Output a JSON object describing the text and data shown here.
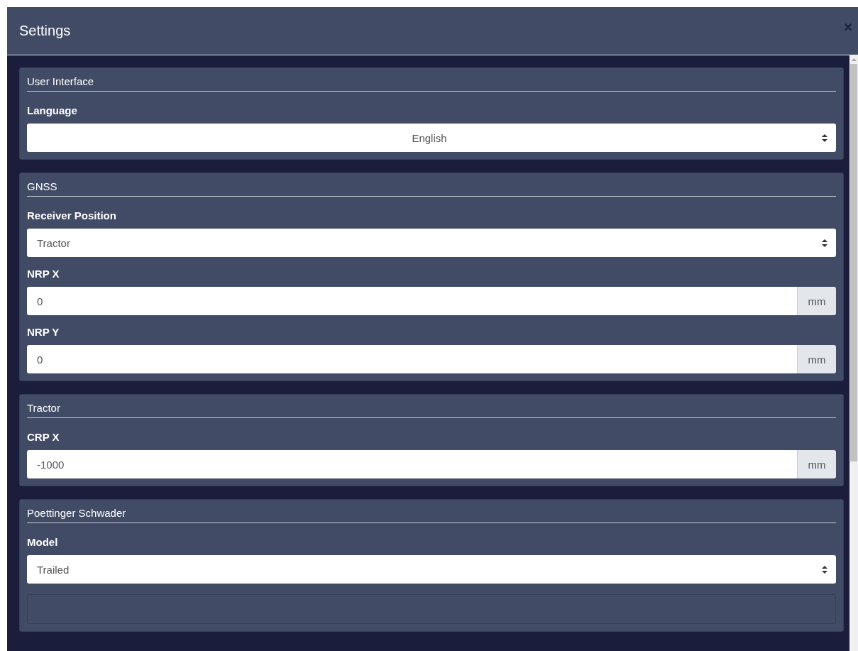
{
  "window": {
    "title": "Settings",
    "close": "×"
  },
  "sections": [
    {
      "title": "User Interface",
      "fields": [
        {
          "kind": "select",
          "label": "Language",
          "value": "English",
          "centered": true
        }
      ]
    },
    {
      "title": "GNSS",
      "fields": [
        {
          "kind": "select",
          "label": "Receiver Position",
          "value": "Tractor",
          "centered": false
        },
        {
          "kind": "number",
          "label": "NRP X",
          "value": "0",
          "unit": "mm"
        },
        {
          "kind": "number",
          "label": "NRP Y",
          "value": "0",
          "unit": "mm"
        }
      ]
    },
    {
      "title": "Tractor",
      "fields": [
        {
          "kind": "number",
          "label": "CRP X",
          "value": "-1000",
          "unit": "mm"
        }
      ]
    },
    {
      "title": "Poettinger Schwader",
      "fields": [
        {
          "kind": "select",
          "label": "Model",
          "value": "Trailed",
          "centered": false
        },
        {
          "kind": "subpanel"
        }
      ]
    }
  ]
}
